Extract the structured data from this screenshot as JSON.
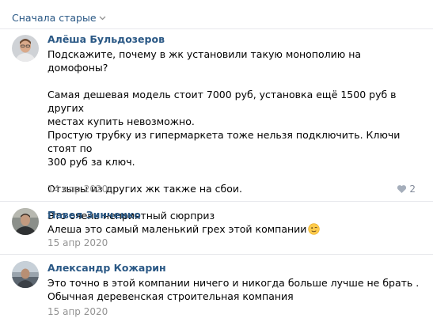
{
  "sort": {
    "label": "Сначала старые",
    "icon": "chevron-down-icon"
  },
  "comments": [
    {
      "author": "Алёша Бульдозеров",
      "paragraphs": [
        "Подскажите, почему в жк установили такую монополию на домофоны?",
        "Самая дешевая модель стоит 7000 руб, установка ещё 1500 руб в других\nместах купить невозможно.\nПростую трубку из гипермаркета тоже нельзя подключить. Ключи стоят по\n300 руб за ключ.",
        "Отзывы из других жк также на сбои.",
        "Это очень неприятный сюрприз"
      ],
      "date": "14 апр 2020",
      "likes": "2",
      "like_icon": "heart-icon"
    },
    {
      "author": "Павел Зинченко",
      "text": "Алеша это самый маленький грех этой компании",
      "emoji": "winking-face-icon",
      "date": "15 апр 2020"
    },
    {
      "author": "Александр Кожарин",
      "text": "Это точно в этой компании ничего и никогда больше лучше не брать .\nОбычная деревенская строительная компания",
      "date": "15 апр 2020"
    }
  ],
  "colors": {
    "link": "#2a5885",
    "meta": "#939393",
    "divider": "#e7e8ec",
    "like": "#828a99"
  }
}
